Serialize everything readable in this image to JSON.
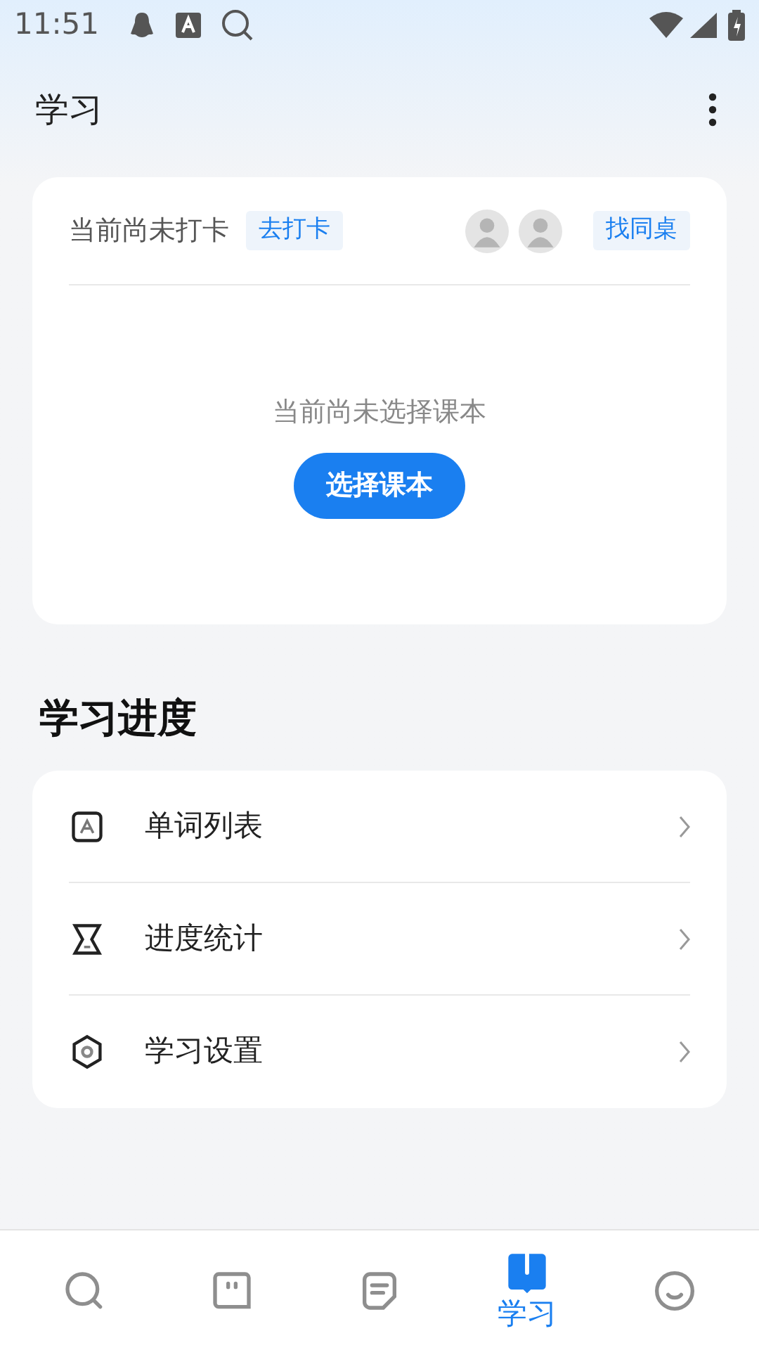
{
  "status_bar": {
    "time": "11:51"
  },
  "header": {
    "title": "学习"
  },
  "checkin_card": {
    "status": "当前尚未打卡",
    "checkin_button": "去打卡",
    "avatars": [
      {
        "kind": "avatar"
      },
      {
        "kind": "avatar"
      }
    ],
    "find_button": "找同桌",
    "empty_text": "当前尚未选择课本",
    "select_button": "选择课本"
  },
  "section_title": "学习进度",
  "menu": [
    {
      "kind": "words",
      "label": "单词列表"
    },
    {
      "kind": "stats",
      "label": "进度统计"
    },
    {
      "kind": "settings",
      "label": "学习设置"
    }
  ],
  "bottom_nav": [
    {
      "kind": "search",
      "selected": false
    },
    {
      "kind": "chat",
      "selected": false
    },
    {
      "kind": "notes",
      "selected": false
    },
    {
      "kind": "study",
      "selected": true,
      "label": "学习"
    },
    {
      "kind": "profile",
      "selected": false
    }
  ]
}
